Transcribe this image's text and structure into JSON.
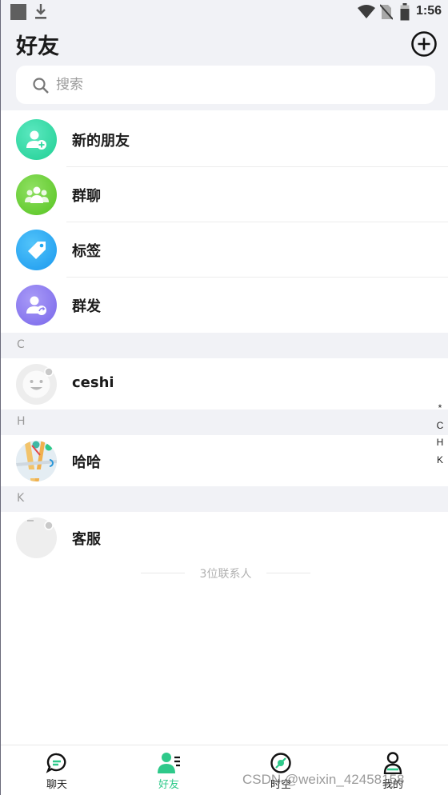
{
  "status_bar": {
    "time": "1:56",
    "icons": [
      "app-square-icon",
      "download-icon",
      "wifi-icon",
      "no-sim-icon",
      "battery-icon"
    ]
  },
  "header": {
    "title": "好友",
    "add_icon": "add-circle-icon"
  },
  "search": {
    "placeholder": "搜索",
    "value": ""
  },
  "feature_items": [
    {
      "label": "新的朋友",
      "icon": "new-friend-icon",
      "color": "#2ed9a0"
    },
    {
      "label": "群聊",
      "icon": "group-chat-icon",
      "color": "#6ad13a"
    },
    {
      "label": "标签",
      "icon": "tag-icon",
      "color": "#1ea8f2"
    },
    {
      "label": "群发",
      "icon": "broadcast-icon",
      "color": "#8a7cf0"
    }
  ],
  "sections": [
    {
      "letter": "C",
      "contacts": [
        {
          "name": "ceshi"
        }
      ]
    },
    {
      "letter": "H",
      "contacts": [
        {
          "name": "哈哈"
        }
      ]
    },
    {
      "letter": "K",
      "contacts": [
        {
          "name": "客服"
        }
      ]
    }
  ],
  "index_bar": [
    "*",
    "C",
    "H",
    "K"
  ],
  "contact_count": "3位联系人",
  "tabs": [
    {
      "label": "聊天",
      "icon": "chat-bubble-icon",
      "active": false
    },
    {
      "label": "好友",
      "icon": "contacts-icon",
      "active": true
    },
    {
      "label": "时空",
      "icon": "discover-icon",
      "active": false
    },
    {
      "label": "我的",
      "icon": "profile-icon",
      "active": false
    }
  ],
  "watermark": "CSDN @weixin_42458158",
  "colors": {
    "accent": "#2ec98a",
    "background": "#f1f2f6"
  }
}
